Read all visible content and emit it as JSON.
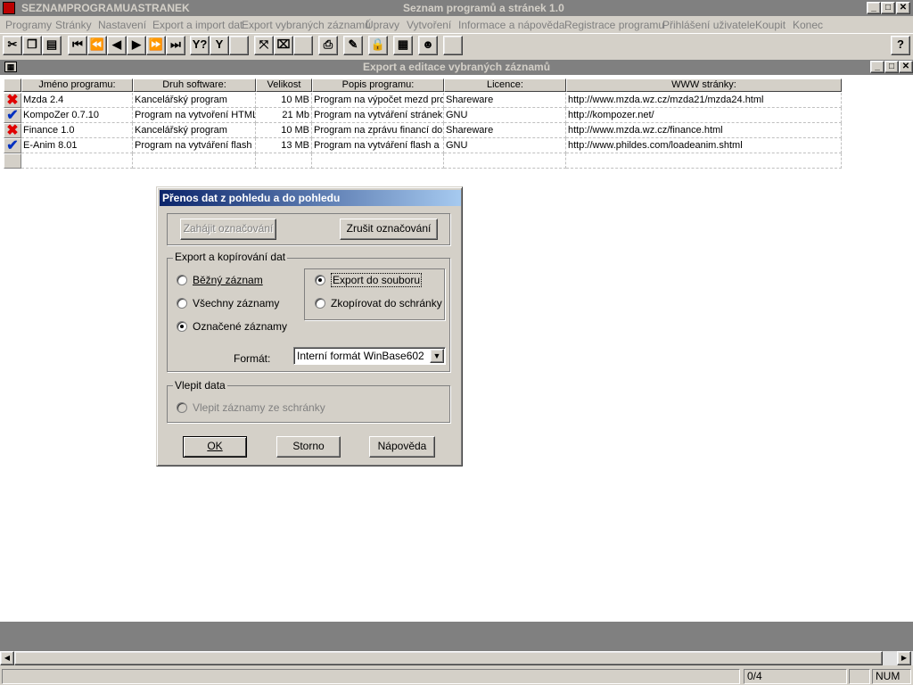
{
  "app": {
    "left_title": "SEZNAMPROGRAMUASTRANEK",
    "center_title": "Seznam programů a stránek 1.0"
  },
  "menu": [
    "Programy",
    "Stránky",
    "Nastavení",
    "Export a import dat",
    "Export vybraných záznamů",
    "Úpravy",
    "Vytvoření",
    "Informace a nápověda",
    "Registrace programu",
    "Přihlášení uživatele",
    "Koupit",
    "Konec"
  ],
  "child": {
    "title": "Export a editace vybraných záznamů"
  },
  "grid": {
    "columns": [
      "Jméno programu:",
      "Druh software:",
      "Velikost",
      "Popis programu:",
      "Licence:",
      "WWW stránky:"
    ],
    "rows": [
      {
        "mark": "x",
        "cells": [
          "Mzda 2.4",
          "Kancelářský program",
          "10 MB",
          "Program na výpočet mezd pro",
          "Shareware",
          "http://www.mzda.wz.cz/mzda21/mzda24.html"
        ]
      },
      {
        "mark": "check",
        "cells": [
          "KompoZer 0.7.10",
          "Program na vytvoření HTML",
          "21 Mb",
          "Program na vytváření stránek.",
          "GNU",
          "http://kompozer.net/"
        ]
      },
      {
        "mark": "x",
        "cells": [
          "Finance 1.0",
          "Kancelářský program",
          "10 MB",
          "Program na zprávu financí don",
          "Shareware",
          "http://www.mzda.wz.cz/finance.html"
        ]
      },
      {
        "mark": "check",
        "cells": [
          "E-Anim 8.01",
          "Program na vytváření flash a",
          "13 MB",
          "Program na vytváření  flash  a",
          "GNU",
          "http://www.phildes.com/loadeanim.shtml"
        ]
      }
    ]
  },
  "dialog": {
    "title": "Přenos dat z pohledu a do pohledu",
    "start_marking": "Zahájit označování",
    "cancel_marking": "Zrušit označování",
    "group_export": "Export a kopírování dat",
    "radio_current": "Běžný záznam",
    "radio_all": "Všechny záznamy",
    "radio_marked": "Označené záznamy",
    "radio_to_file": "Export do souboru",
    "radio_to_clipboard": "Zkopírovat do schránky",
    "format_label": "Formát:",
    "format_value": "Interní formát WinBase602",
    "group_paste": "Vlepit data",
    "radio_paste": "Vlepit záznamy ze schránky",
    "ok": "OK",
    "cancel": "Storno",
    "help": "Nápověda"
  },
  "status": {
    "record_count": "0/4",
    "num": "NUM"
  }
}
